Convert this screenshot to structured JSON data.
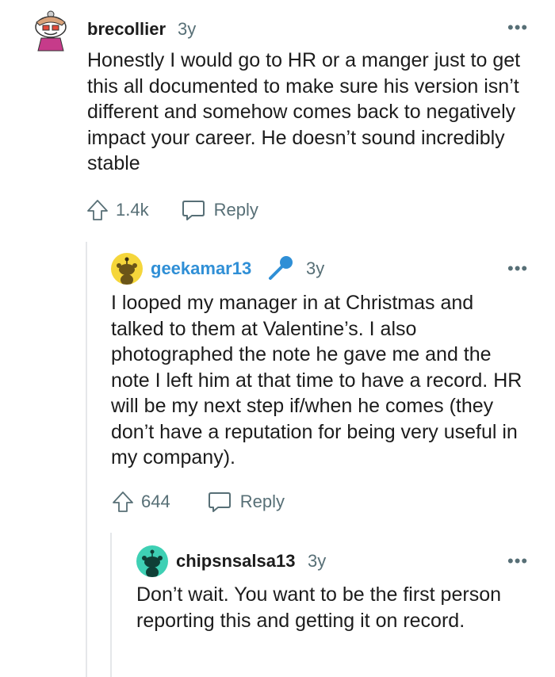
{
  "comments": [
    {
      "username": "brecollier",
      "age": "3y",
      "more": "•••",
      "body": "Honestly I would go to HR or a manger just to get this all documented to make sure his version isn’t different and somehow comes back to negatively impact your career. He doesn’t sound incredibly stable",
      "score": "1.4k",
      "reply_label": "Reply"
    },
    {
      "username": "geekamar13",
      "is_op": true,
      "age": "3y",
      "more": "•••",
      "body": "I looped my manager in at Christmas and talked to them at Valentine’s. I also photographed the note he gave me and the note I left him at that time to have a record. HR will be my next step if/when he comes (they don’t have a reputation for being very useful in my company).",
      "score": "644",
      "reply_label": "Reply"
    },
    {
      "username": "chipsnsalsa13",
      "age": "3y",
      "more": "•••",
      "body": "Don’t wait. You want to be the first person reporting this and getting it on record."
    }
  ],
  "colors": {
    "op_username": "#2f8fd6",
    "mic_icon": "#2f8fd6",
    "thread_line": "#e5e7ea",
    "meta_text": "#576f76",
    "avatar_teal": "#3ed0b4",
    "avatar_yellow": "#f5d63b"
  },
  "icons": [
    "snoo-avatar-icon",
    "microphone-icon",
    "upvote-icon",
    "reply-bubble-icon",
    "more-options-icon"
  ]
}
